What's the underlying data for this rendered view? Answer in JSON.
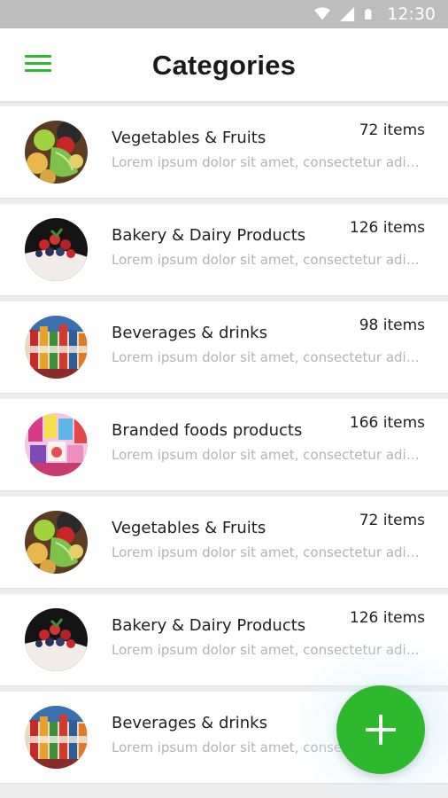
{
  "status_bar": {
    "time": "12:30",
    "icons": [
      "wifi-icon",
      "signal-icon",
      "battery-icon"
    ]
  },
  "header": {
    "title": "Categories",
    "menu_icon": "hamburger-menu-icon"
  },
  "theme": {
    "accent": "#2eb82e",
    "background": "#ececec",
    "card": "#ffffff",
    "muted_text": "#b3b3b3"
  },
  "categories": [
    {
      "name": "Vegetables & Fruits",
      "count": "72 items",
      "description": "Lorem ipsum dolor sit amet, consectetur adip...",
      "image": "vegetables-fruits-image"
    },
    {
      "name": "Bakery & Dairy Products",
      "count": "126 items",
      "description": "Lorem ipsum dolor sit amet, consectetur adip...",
      "image": "bakery-dairy-image"
    },
    {
      "name": "Beverages & drinks",
      "count": "98 items",
      "description": "Lorem ipsum dolor sit amet, consectetur adip...",
      "image": "beverages-image"
    },
    {
      "name": "Branded foods products",
      "count": "166 items",
      "description": "Lorem ipsum dolor sit amet, consectetur adip...",
      "image": "branded-foods-image"
    },
    {
      "name": "Vegetables & Fruits",
      "count": "72 items",
      "description": "Lorem ipsum dolor sit amet, consectetur adip...",
      "image": "vegetables-fruits-image"
    },
    {
      "name": "Bakery & Dairy Products",
      "count": "126 items",
      "description": "Lorem ipsum dolor sit amet, consectetur adip...",
      "image": "bakery-dairy-image"
    },
    {
      "name": "Beverages & drinks",
      "count": "",
      "description": "Lorem ipsum dolor sit amet, consectetur adip...",
      "image": "beverages-image"
    }
  ],
  "fab": {
    "icon": "plus-icon"
  }
}
